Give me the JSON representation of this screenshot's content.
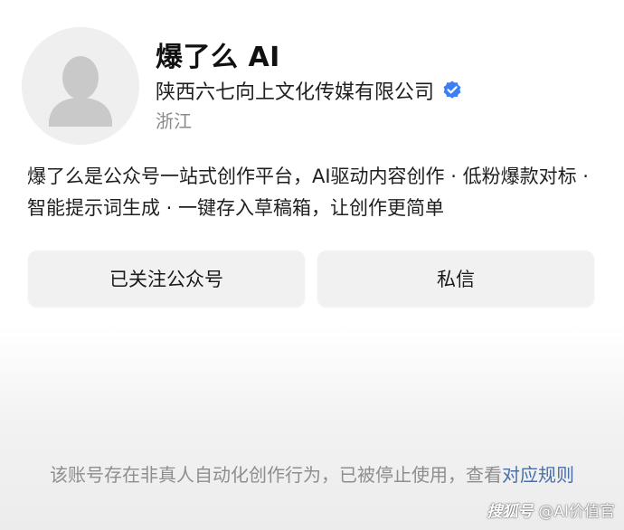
{
  "profile": {
    "name": "爆了么 AI",
    "organization": "陕西六七向上文化传媒有限公司",
    "location": "浙江",
    "verified_color": "#3d7ef5"
  },
  "description": "爆了么是公众号一站式创作平台，AI驱动内容创作 · 低粉爆款对标 · 智能提示词生成 · 一键存入草稿箱，让创作更简单",
  "actions": {
    "follow_label": "已关注公众号",
    "message_label": "私信"
  },
  "notice": {
    "text": "该账号存在非真人自动化创作行为，已被停止使用，查看",
    "link_label": "对应规则"
  },
  "watermark": {
    "logo": "搜狐号",
    "text": "@AI价值官"
  },
  "icons": {
    "avatar": "default-avatar-icon",
    "verified": "verified-badge-icon"
  }
}
